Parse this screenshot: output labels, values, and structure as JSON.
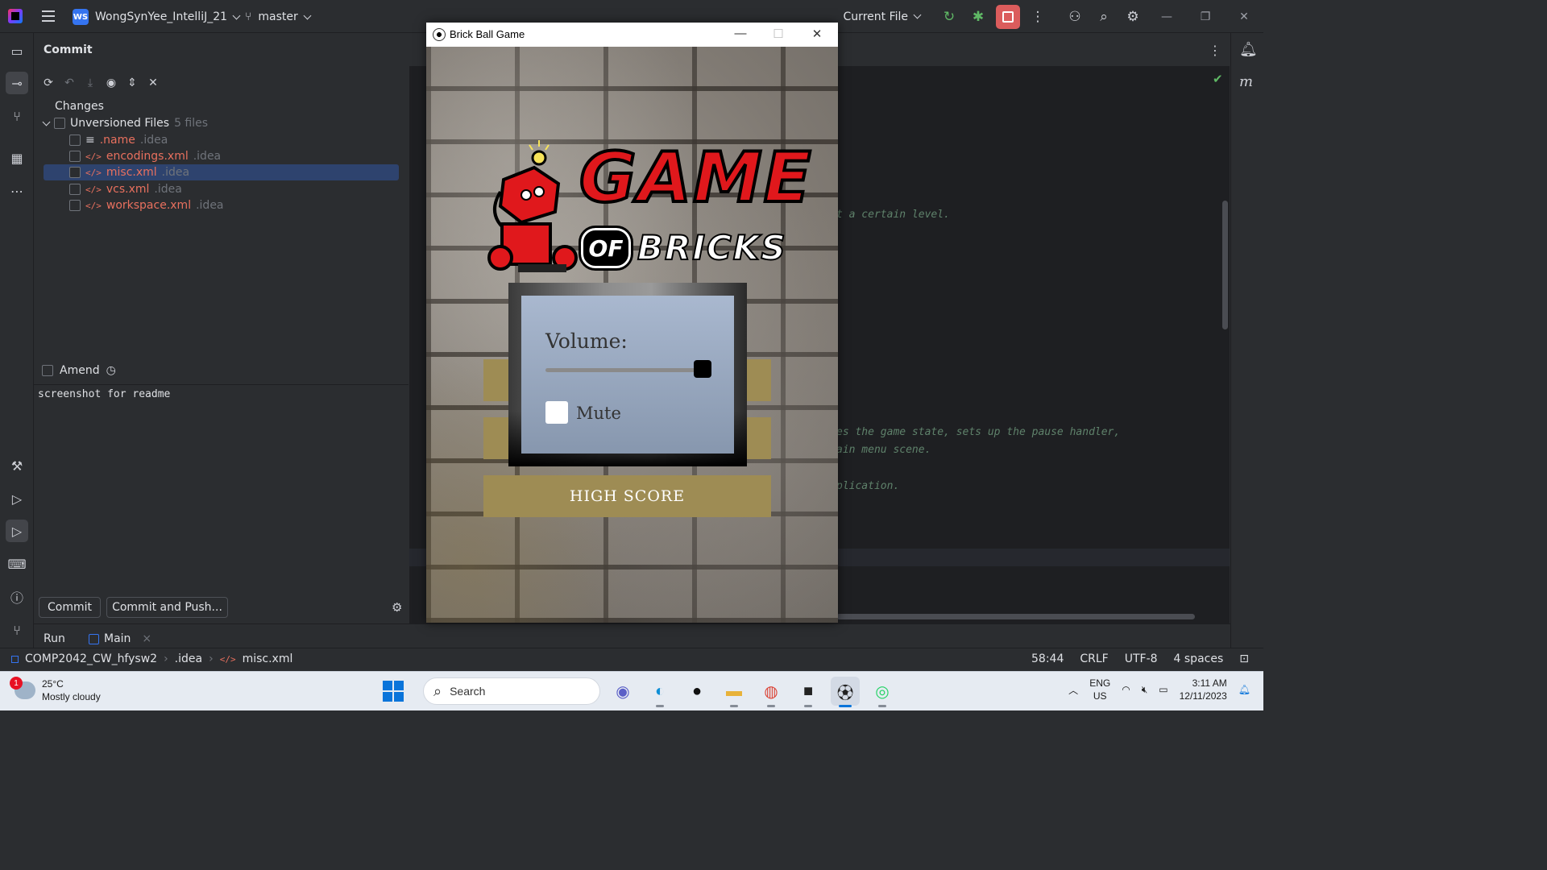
{
  "ide": {
    "project_badge": "WS",
    "project_name": "WongSynYee_IntelliJ_21",
    "branch": "master",
    "run_config": "Current File"
  },
  "commit_panel": {
    "title": "Commit",
    "changes_label": "Changes",
    "group_label": "Unversioned Files",
    "group_count": "5 files",
    "files": [
      {
        "name": ".name",
        "dir": ".idea",
        "icon": "text-file-icon"
      },
      {
        "name": "encodings.xml",
        "dir": ".idea",
        "icon": "xml-icon"
      },
      {
        "name": "misc.xml",
        "dir": ".idea",
        "icon": "xml-icon"
      },
      {
        "name": "vcs.xml",
        "dir": ".idea",
        "icon": "xml-icon"
      },
      {
        "name": "workspace.xml",
        "dir": ".idea",
        "icon": "xml-icon"
      }
    ],
    "amend_label": "Amend",
    "commit_message": "screenshot for readme",
    "commit_button": "Commit",
    "commit_push_button": "Commit and Push..."
  },
  "editor": {
    "lines": [
      "t a certain level.",
      "es the game state, sets up the pause handler,",
      "ain menu scene.",
      "plication."
    ]
  },
  "run_bar": {
    "run_label": "Run",
    "tab_label": "Main"
  },
  "status_bar": {
    "breadcrumb": [
      "COMP2042_CW_hfysw2",
      ".idea",
      "misc.xml"
    ],
    "position": "58:44",
    "line_sep": "CRLF",
    "encoding": "UTF-8",
    "indent": "4 spaces"
  },
  "game_window": {
    "title": "Brick Ball Game",
    "logo_word1": "GAME",
    "logo_of": "OF",
    "logo_word2": "BRICKS",
    "volume_label": "Volume:",
    "volume_level": 0.95,
    "mute_label": "Mute",
    "mute_checked": false,
    "high_score_button": "HIGH SCORE"
  },
  "taskbar": {
    "weather_temp": "25°C",
    "weather_desc": "Mostly cloudy",
    "weather_badge": "1",
    "search_placeholder": "Search",
    "lang_top": "ENG",
    "lang_bottom": "US",
    "time": "3:11 AM",
    "date": "12/11/2023"
  }
}
